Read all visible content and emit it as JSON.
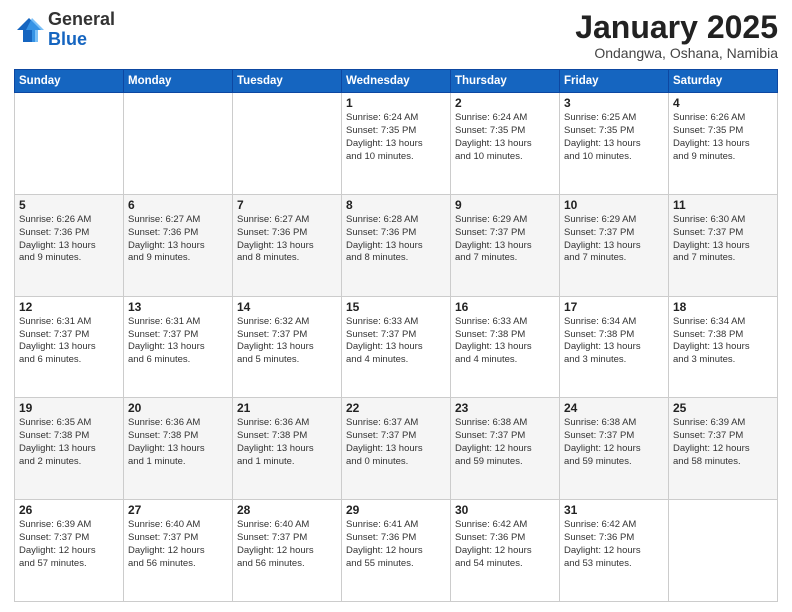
{
  "header": {
    "logo": {
      "general": "General",
      "blue": "Blue"
    },
    "title": "January 2025",
    "subtitle": "Ondangwa, Oshana, Namibia"
  },
  "days_of_week": [
    "Sunday",
    "Monday",
    "Tuesday",
    "Wednesday",
    "Thursday",
    "Friday",
    "Saturday"
  ],
  "weeks": [
    [
      {
        "day": "",
        "info": ""
      },
      {
        "day": "",
        "info": ""
      },
      {
        "day": "",
        "info": ""
      },
      {
        "day": "1",
        "info": "Sunrise: 6:24 AM\nSunset: 7:35 PM\nDaylight: 13 hours\nand 10 minutes."
      },
      {
        "day": "2",
        "info": "Sunrise: 6:24 AM\nSunset: 7:35 PM\nDaylight: 13 hours\nand 10 minutes."
      },
      {
        "day": "3",
        "info": "Sunrise: 6:25 AM\nSunset: 7:35 PM\nDaylight: 13 hours\nand 10 minutes."
      },
      {
        "day": "4",
        "info": "Sunrise: 6:26 AM\nSunset: 7:35 PM\nDaylight: 13 hours\nand 9 minutes."
      }
    ],
    [
      {
        "day": "5",
        "info": "Sunrise: 6:26 AM\nSunset: 7:36 PM\nDaylight: 13 hours\nand 9 minutes."
      },
      {
        "day": "6",
        "info": "Sunrise: 6:27 AM\nSunset: 7:36 PM\nDaylight: 13 hours\nand 9 minutes."
      },
      {
        "day": "7",
        "info": "Sunrise: 6:27 AM\nSunset: 7:36 PM\nDaylight: 13 hours\nand 8 minutes."
      },
      {
        "day": "8",
        "info": "Sunrise: 6:28 AM\nSunset: 7:36 PM\nDaylight: 13 hours\nand 8 minutes."
      },
      {
        "day": "9",
        "info": "Sunrise: 6:29 AM\nSunset: 7:37 PM\nDaylight: 13 hours\nand 7 minutes."
      },
      {
        "day": "10",
        "info": "Sunrise: 6:29 AM\nSunset: 7:37 PM\nDaylight: 13 hours\nand 7 minutes."
      },
      {
        "day": "11",
        "info": "Sunrise: 6:30 AM\nSunset: 7:37 PM\nDaylight: 13 hours\nand 7 minutes."
      }
    ],
    [
      {
        "day": "12",
        "info": "Sunrise: 6:31 AM\nSunset: 7:37 PM\nDaylight: 13 hours\nand 6 minutes."
      },
      {
        "day": "13",
        "info": "Sunrise: 6:31 AM\nSunset: 7:37 PM\nDaylight: 13 hours\nand 6 minutes."
      },
      {
        "day": "14",
        "info": "Sunrise: 6:32 AM\nSunset: 7:37 PM\nDaylight: 13 hours\nand 5 minutes."
      },
      {
        "day": "15",
        "info": "Sunrise: 6:33 AM\nSunset: 7:37 PM\nDaylight: 13 hours\nand 4 minutes."
      },
      {
        "day": "16",
        "info": "Sunrise: 6:33 AM\nSunset: 7:38 PM\nDaylight: 13 hours\nand 4 minutes."
      },
      {
        "day": "17",
        "info": "Sunrise: 6:34 AM\nSunset: 7:38 PM\nDaylight: 13 hours\nand 3 minutes."
      },
      {
        "day": "18",
        "info": "Sunrise: 6:34 AM\nSunset: 7:38 PM\nDaylight: 13 hours\nand 3 minutes."
      }
    ],
    [
      {
        "day": "19",
        "info": "Sunrise: 6:35 AM\nSunset: 7:38 PM\nDaylight: 13 hours\nand 2 minutes."
      },
      {
        "day": "20",
        "info": "Sunrise: 6:36 AM\nSunset: 7:38 PM\nDaylight: 13 hours\nand 1 minute."
      },
      {
        "day": "21",
        "info": "Sunrise: 6:36 AM\nSunset: 7:38 PM\nDaylight: 13 hours\nand 1 minute."
      },
      {
        "day": "22",
        "info": "Sunrise: 6:37 AM\nSunset: 7:37 PM\nDaylight: 13 hours\nand 0 minutes."
      },
      {
        "day": "23",
        "info": "Sunrise: 6:38 AM\nSunset: 7:37 PM\nDaylight: 12 hours\nand 59 minutes."
      },
      {
        "day": "24",
        "info": "Sunrise: 6:38 AM\nSunset: 7:37 PM\nDaylight: 12 hours\nand 59 minutes."
      },
      {
        "day": "25",
        "info": "Sunrise: 6:39 AM\nSunset: 7:37 PM\nDaylight: 12 hours\nand 58 minutes."
      }
    ],
    [
      {
        "day": "26",
        "info": "Sunrise: 6:39 AM\nSunset: 7:37 PM\nDaylight: 12 hours\nand 57 minutes."
      },
      {
        "day": "27",
        "info": "Sunrise: 6:40 AM\nSunset: 7:37 PM\nDaylight: 12 hours\nand 56 minutes."
      },
      {
        "day": "28",
        "info": "Sunrise: 6:40 AM\nSunset: 7:37 PM\nDaylight: 12 hours\nand 56 minutes."
      },
      {
        "day": "29",
        "info": "Sunrise: 6:41 AM\nSunset: 7:36 PM\nDaylight: 12 hours\nand 55 minutes."
      },
      {
        "day": "30",
        "info": "Sunrise: 6:42 AM\nSunset: 7:36 PM\nDaylight: 12 hours\nand 54 minutes."
      },
      {
        "day": "31",
        "info": "Sunrise: 6:42 AM\nSunset: 7:36 PM\nDaylight: 12 hours\nand 53 minutes."
      },
      {
        "day": "",
        "info": ""
      }
    ]
  ]
}
